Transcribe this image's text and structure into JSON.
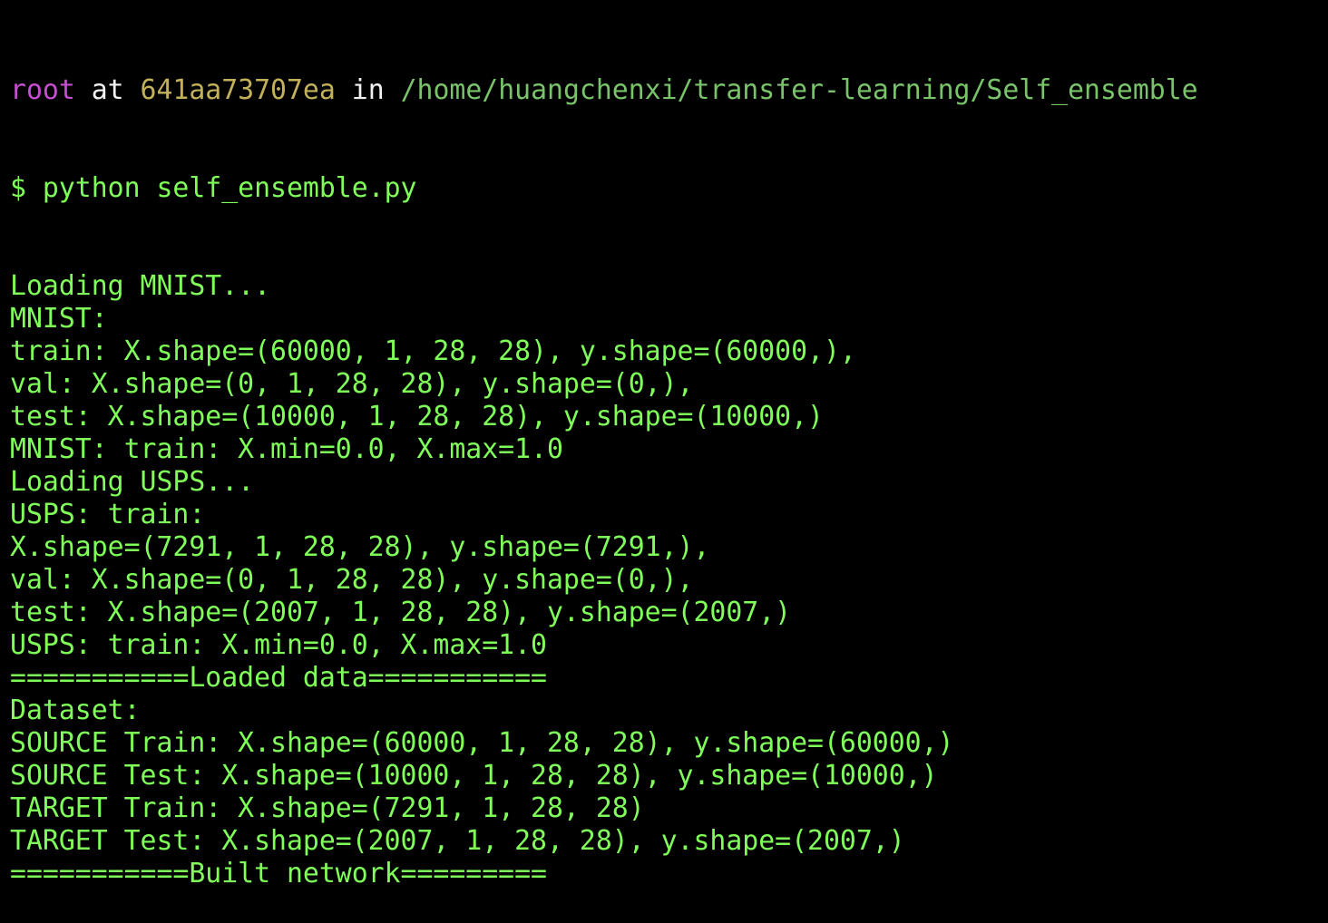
{
  "colors": {
    "background": "#000000",
    "user": "#c64ed0",
    "host": "#c3b15a",
    "path": "#79c46a",
    "plain": "#f2f2f2",
    "output": "#80ff5a"
  },
  "prompt": {
    "user": "root",
    "at": " at ",
    "host": "641aa73707ea",
    "in": " in ",
    "path": "/home/huangchenxi/transfer-learning/Self_ensemble"
  },
  "command": {
    "symbol": "$ ",
    "text": "python self_ensemble.py"
  },
  "output": [
    "Loading MNIST...",
    "MNIST:",
    "train: X.shape=(60000, 1, 28, 28), y.shape=(60000,),",
    "val: X.shape=(0, 1, 28, 28), y.shape=(0,),",
    "test: X.shape=(10000, 1, 28, 28), y.shape=(10000,)",
    "MNIST: train: X.min=0.0, X.max=1.0",
    "Loading USPS...",
    "USPS: train:",
    "X.shape=(7291, 1, 28, 28), y.shape=(7291,),",
    "val: X.shape=(0, 1, 28, 28), y.shape=(0,),",
    "test: X.shape=(2007, 1, 28, 28), y.shape=(2007,)",
    "USPS: train: X.min=0.0, X.max=1.0",
    "===========Loaded data===========",
    "Dataset:",
    "SOURCE Train: X.shape=(60000, 1, 28, 28), y.shape=(60000,)",
    "SOURCE Test: X.shape=(10000, 1, 28, 28), y.shape=(10000,)",
    "TARGET Train: X.shape=(7291, 1, 28, 28)",
    "TARGET Test: X.shape=(2007, 1, 28, 28), y.shape=(2007,)",
    "===========Built network========="
  ]
}
